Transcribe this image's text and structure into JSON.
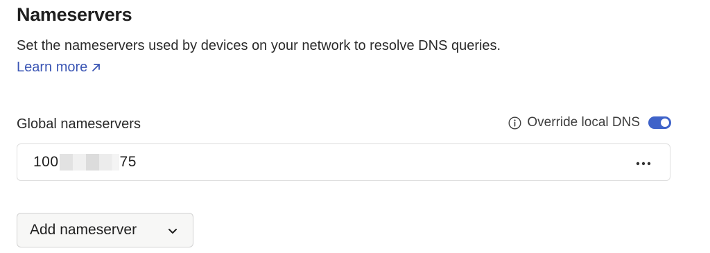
{
  "section": {
    "title": "Nameservers",
    "description": "Set the nameservers used by devices on your network to resolve DNS queries.",
    "learn_more_label": "Learn more"
  },
  "global_nameservers": {
    "label": "Global nameservers",
    "override_label": "Override local DNS",
    "override_enabled": true,
    "toggle_color": "#3f63c9",
    "entries": [
      {
        "prefix": "100",
        "suffix": "75"
      }
    ]
  },
  "actions": {
    "add_nameserver_label": "Add nameserver"
  },
  "colors": {
    "link": "#3a55b4",
    "text": "#1f1f1f",
    "border": "#dedede"
  },
  "icons": {
    "learn_more": "external-arrow-icon",
    "override_info": "info-icon",
    "row_menu": "ellipsis-icon",
    "dropdown": "chevron-down-icon"
  }
}
